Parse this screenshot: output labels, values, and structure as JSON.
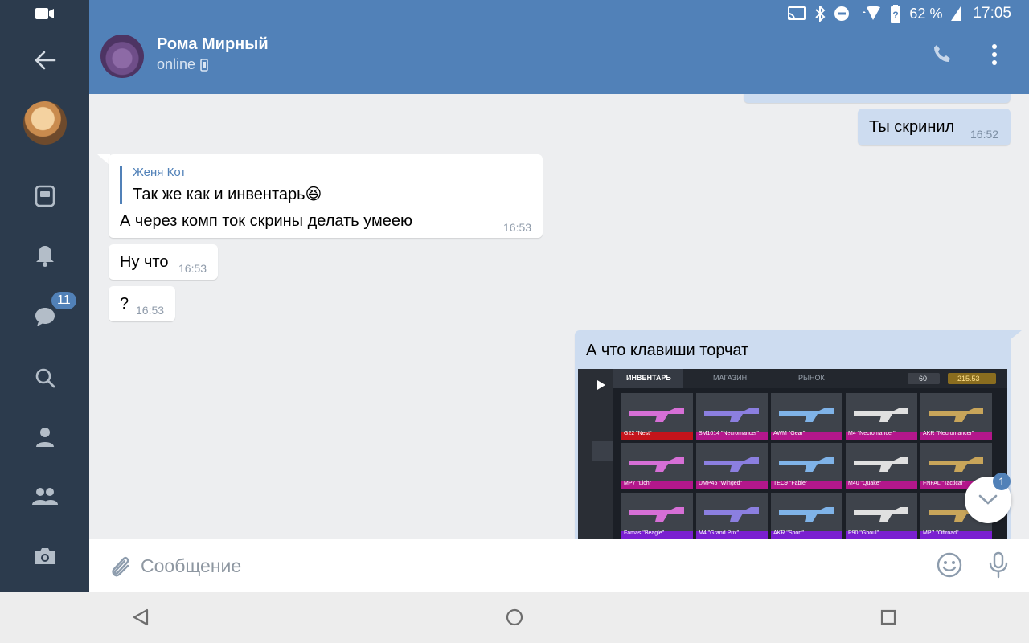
{
  "rail": {
    "unread_badge": "11"
  },
  "status_bar": {
    "battery": "62 %",
    "time": "17:05"
  },
  "contact": {
    "name": "Рома Мирный",
    "status": "online"
  },
  "messages": {
    "m1": {
      "text": "Ты скринил",
      "time": "16:52"
    },
    "m2": {
      "reply_author": "Женя Кот",
      "reply_text": "Так же как и инвентарь😆",
      "text": "А через комп ток скрины делать умеею",
      "time": "16:53"
    },
    "m3": {
      "text": "Ну что",
      "time": "16:53"
    },
    "m4": {
      "text": "?",
      "time": "16:53"
    },
    "m5": {
      "text": "А что клавиши торчат"
    }
  },
  "screenshot": {
    "tabs": [
      "ИНВЕНТАРЬ",
      "МАГАЗИН",
      "РЫНОК"
    ],
    "currency_silver": "60",
    "currency_gold": "215.53",
    "items": [
      "G22 \"Nest\"",
      "SM1014 \"Necromancer\"",
      "AWM \"Gear\"",
      "M4 \"Necromancer\"",
      "AKR \"Necromancer\"",
      "MP7 \"Lich\"",
      "UMP45 \"Winged\"",
      "TEC9 \"Fable\"",
      "M40 \"Quake\"",
      "FNFAL \"Tactical\"",
      "Famas \"Beagle\"",
      "M4 \"Grand Prix\"",
      "AKR \"Sport\"",
      "P90 \"Ghoul\"",
      "MP7 \"Offroad\""
    ]
  },
  "scroll_down_badge": "1",
  "composer": {
    "placeholder": "Сообщение"
  }
}
